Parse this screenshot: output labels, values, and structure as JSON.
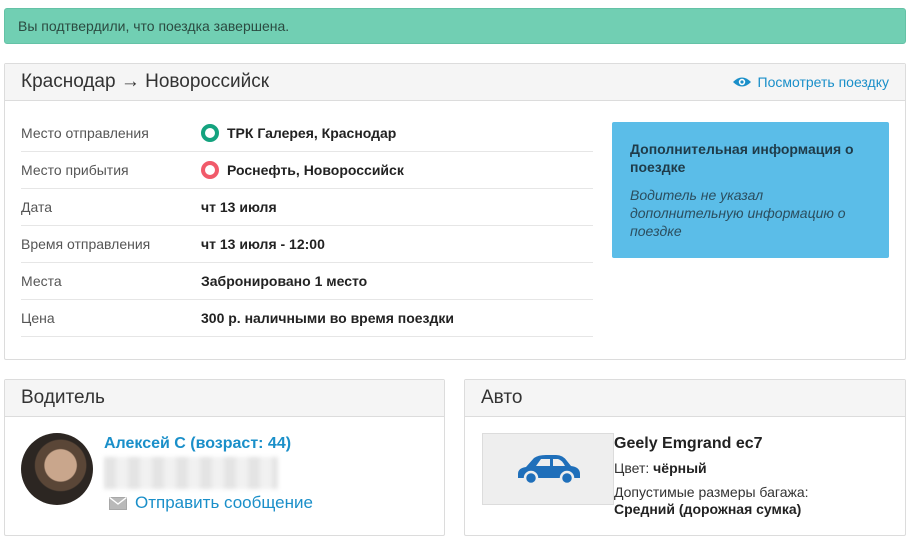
{
  "alert": {
    "text": "Вы подтвердили, что поездка завершена."
  },
  "trip": {
    "title": "Краснодар → Новороссийск",
    "view_link": "Посмотреть поездку",
    "rows": [
      {
        "label": "Место отправления",
        "value": "ТРК Галерея, Краснодар"
      },
      {
        "label": "Место прибытия",
        "value": "Роснефть, Новороссийск"
      },
      {
        "label": "Дата",
        "value": "чт 13 июля"
      },
      {
        "label": "Время отправления",
        "value": "чт 13 июля - 12:00"
      },
      {
        "label": "Места",
        "value": "Забронировано 1 место"
      },
      {
        "label": "Цена",
        "value": "300 р. наличными во время поездки"
      }
    ],
    "info": {
      "title": "Дополнительная информация о поездке",
      "text": "Водитель не указал дополнительную информацию о поездке"
    }
  },
  "driver": {
    "title": "Водитель",
    "name": "Алексей С (возраст: 44)",
    "send_message": "Отправить сообщение"
  },
  "car": {
    "title": "Авто",
    "model": "Geely Emgrand ec7",
    "color_label": "Цвет:",
    "color_value": "чёрный",
    "luggage_label": "Допустимые размеры багажа:",
    "luggage_value": "Средний (дорожная сумка)"
  },
  "colors": {
    "accent": "#1a8fc9",
    "success": "#71cfb3",
    "info": "#5bbde8",
    "car_icon": "#1f6fba"
  },
  "icons": {
    "view": "eye-icon",
    "origin": "green-ring-icon",
    "destination": "red-ring-icon",
    "message": "envelope-icon",
    "car": "car-icon"
  }
}
